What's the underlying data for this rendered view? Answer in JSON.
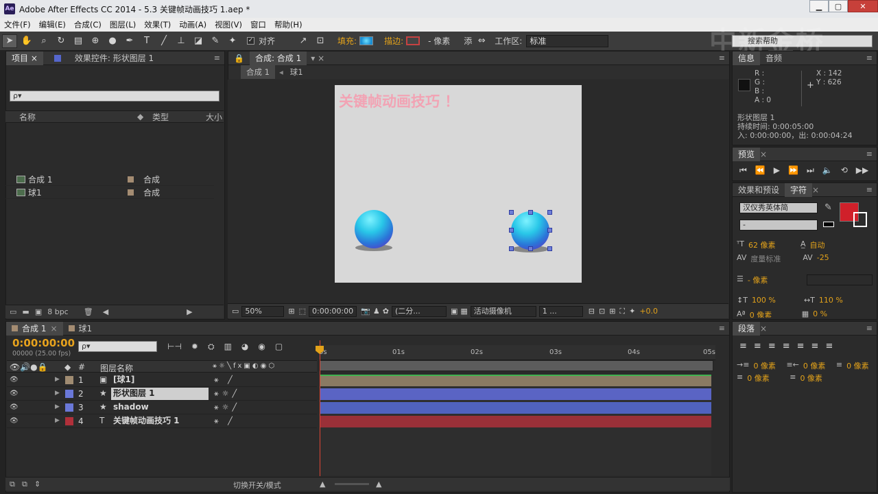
{
  "titlebar": {
    "title": "Adobe After Effects CC 2014 - 5.3 关键帧动画技巧 1.aep *",
    "logo": "Ae"
  },
  "menu": [
    "文件(F)",
    "编辑(E)",
    "合成(C)",
    "图层(L)",
    "效果(T)",
    "动画(A)",
    "视图(V)",
    "窗口",
    "帮助(H)"
  ],
  "toolbar": {
    "align_label": "对齐",
    "fill_label": "填充:",
    "stroke_label": "描边:",
    "pixel_label": "- 像素",
    "add_label": "添",
    "workspace_label": "工作区:",
    "workspace_value": "标准",
    "search_help": "搜索帮助"
  },
  "watermark": "中新金桥",
  "project_panel": {
    "tabs": [
      "项目 ×",
      "效果控件: 形状图层 1"
    ],
    "search_placeholder": "ρ▾",
    "columns": {
      "name": "名称",
      "type": "类型",
      "size": "大小"
    },
    "items": [
      {
        "name": "合成 1",
        "type": "合成"
      },
      {
        "name": "球1",
        "type": "合成"
      }
    ],
    "bpc": "8 bpc"
  },
  "comp_panel": {
    "tab": "合成: 合成 1",
    "breadcrumbs": [
      "合成 1",
      "球1"
    ],
    "canvas_text": "关键帧动画技巧 ！",
    "zoom": "50%",
    "timecode": "0:00:00:00",
    "resolution": "(二分...",
    "camera": "活动摄像机",
    "views": "1 ...",
    "exposure": "+0.0"
  },
  "info_panel": {
    "tabs": [
      "信息",
      "音频"
    ],
    "r": "R :",
    "g": "G :",
    "b": "B :",
    "a": "A : 0",
    "x": "X : 142",
    "y": "Y : 626",
    "layer": "形状图层 1",
    "duration": "持续时间: 0:00:05:00",
    "inout": "入: 0:00:00:00，出: 0:00:04:24"
  },
  "preview_panel": {
    "tab": "预览"
  },
  "char_panel": {
    "tabs": [
      "效果和预设",
      "字符"
    ],
    "font": "汉仪秀英体简",
    "style": "-",
    "size": "62 像素",
    "leading": "自动",
    "kerning": "度量标准",
    "tracking": "-25",
    "stroke_width": "- 像素",
    "vscale": "100 %",
    "hscale": "110 %",
    "baseline": "0 像素",
    "tsume": "0 %",
    "fill_color": "#d0202a"
  },
  "para_panel": {
    "tab": "段落",
    "indent_left": "0 像素",
    "indent_right": "0 像素",
    "indent_first": "0 像素",
    "space_before": "0 像素",
    "space_after": "0 像素"
  },
  "timeline": {
    "tabs": [
      "合成 1",
      "球1"
    ],
    "time": "0:00:00:00",
    "frames": "00000 (25.00 fps)",
    "search_placeholder": "ρ▾",
    "col_num": "#",
    "col_name": "图层名称",
    "ruler": [
      "0s",
      "01s",
      "02s",
      "03s",
      "04s",
      "05s"
    ],
    "layers": [
      {
        "num": "1",
        "name": "[球1]",
        "color": "#a08c72",
        "bar": "#8a7a63",
        "type": "comp"
      },
      {
        "num": "2",
        "name": "形状图层 1",
        "color": "#6a78d8",
        "bar": "#5a64c4",
        "type": "shape"
      },
      {
        "num": "3",
        "name": "shadow",
        "color": "#6a78d8",
        "bar": "#5062be",
        "type": "shape"
      },
      {
        "num": "4",
        "name": "关键帧动画技巧 1",
        "color": "#b0303a",
        "bar": "#9a3038",
        "type": "text"
      }
    ],
    "footer_toggle": "切换开关/模式"
  }
}
